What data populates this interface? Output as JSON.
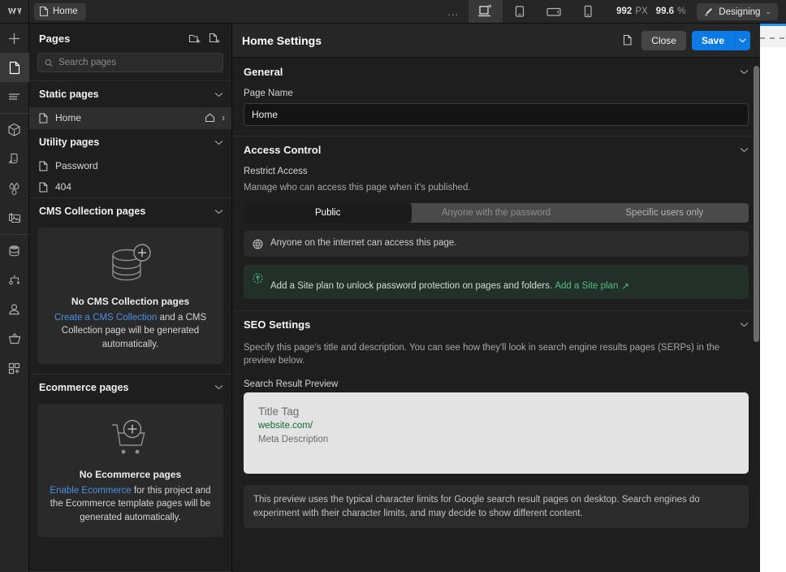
{
  "topbar": {
    "logo": "webflow-logo",
    "page_tab": {
      "label": "Home",
      "icon": "page-icon"
    },
    "more_label": "...",
    "breakpoints": [
      {
        "name": "desktop",
        "icon": "desktop-icon",
        "active": true
      },
      {
        "name": "tablet",
        "icon": "tablet-icon",
        "active": false
      },
      {
        "name": "mobile-landscape",
        "icon": "mobile-landscape-icon",
        "active": false
      },
      {
        "name": "mobile-portrait",
        "icon": "mobile-portrait-icon",
        "active": false
      }
    ],
    "canvas_width": "992",
    "canvas_width_unit": "PX",
    "zoom_value": "99.6",
    "zoom_unit": "%",
    "mode": {
      "label": "Designing",
      "icon": "brush-icon",
      "caret": "⌄"
    }
  },
  "rail": {
    "items": [
      {
        "name": "add-panel",
        "icon": "plus-icon",
        "active": false
      },
      {
        "name": "pages-panel",
        "icon": "page-icon",
        "active": true
      },
      {
        "name": "navigator-panel",
        "icon": "navigator-icon",
        "active": false
      },
      {
        "name": "components-panel",
        "icon": "cube-icon",
        "active": false
      },
      {
        "name": "style-panel",
        "icon": "style-icon",
        "active": false
      },
      {
        "name": "variables-panel",
        "icon": "droplets-icon",
        "active": false
      },
      {
        "name": "assets-panel",
        "icon": "image-icon",
        "active": false
      },
      {
        "name": "cms-panel",
        "icon": "database-icon",
        "active": false
      },
      {
        "name": "logic-panel",
        "icon": "logic-icon",
        "active": false
      },
      {
        "name": "users-panel",
        "icon": "user-icon",
        "active": false
      },
      {
        "name": "ecommerce-panel",
        "icon": "basket-icon",
        "active": false
      },
      {
        "name": "apps-panel",
        "icon": "apps-grid-icon",
        "active": false
      }
    ]
  },
  "pages": {
    "title": "Pages",
    "new_folder_icon": "new-folder-icon",
    "new_page_icon": "new-page-icon",
    "search": {
      "placeholder": "Search pages",
      "value": "",
      "icon": "search-icon"
    },
    "sections": [
      {
        "title": "Static pages",
        "collapse_icon": "chevron-down-icon",
        "items": [
          {
            "label": "Home",
            "icon": "page-icon",
            "selected": true,
            "home_icon": "home-icon",
            "chevron": "›"
          }
        ]
      },
      {
        "title": "Utility pages",
        "collapse_icon": "chevron-down-icon",
        "items": [
          {
            "label": "Password",
            "icon": "page-icon",
            "selected": false
          },
          {
            "label": "404",
            "icon": "page-icon",
            "selected": false
          }
        ]
      }
    ],
    "cms": {
      "title": "CMS Collection pages",
      "collapse_icon": "chevron-down-icon",
      "illustration": "database-plus-icon",
      "empty_title": "No CMS Collection pages",
      "empty_link": "Create a CMS Collection",
      "empty_text_rest": " and a CMS Collection page will be generated automatically."
    },
    "ecommerce": {
      "title": "Ecommerce pages",
      "collapse_icon": "chevron-down-icon",
      "illustration": "cart-plus-icon",
      "empty_title": "No Ecommerce pages",
      "empty_link": "Enable Ecommerce",
      "empty_text_rest": " for this project and the Ecommerce template pages will be generated automatically."
    }
  },
  "settings": {
    "title": "Home Settings",
    "duplicate_icon": "duplicate-icon",
    "close_label": "Close",
    "save_label": "Save",
    "save_caret": "⌄",
    "general": {
      "title": "General",
      "collapse_icon": "chevron-down-icon",
      "page_name_label": "Page Name",
      "page_name_value": "Home"
    },
    "access": {
      "title": "Access Control",
      "collapse_icon": "chevron-down-icon",
      "restrict_label": "Restrict Access",
      "restrict_sub": "Manage who can access this page when it's published.",
      "options": [
        {
          "label": "Public",
          "selected": true
        },
        {
          "label": "Anyone with the password",
          "selected": false,
          "disabled": true
        },
        {
          "label": "Specific users only",
          "selected": false
        }
      ],
      "info_note": {
        "icon": "globe-icon",
        "text": "Anyone on the internet can access this page."
      },
      "upgrade_note": {
        "icon": "upgrade-icon",
        "text": "Add a Site plan to unlock password protection on pages and folders.",
        "link_label": "Add a Site plan",
        "link_arrow": "↗"
      }
    },
    "seo": {
      "title": "SEO Settings",
      "collapse_icon": "chevron-down-icon",
      "description": "Specify this page's title and description. You can see how they'll look in search engine results pages (SERPs) in the preview below.",
      "preview_label": "Search Result Preview",
      "preview": {
        "title_tag": "Title Tag",
        "url": "website.com/",
        "meta_description": "Meta Description"
      },
      "footnote": "This preview uses the typical character limits for Google search result pages on desktop. Search engines do experiment with their character limits, and may decide to show different content."
    }
  }
}
